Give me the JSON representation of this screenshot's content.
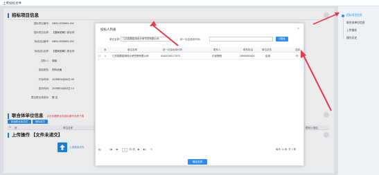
{
  "topbar": {
    "title": "上传投标文件"
  },
  "main": {
    "section1_title": "招标项目信息",
    "fields": [
      {
        "label": "招标项目编号:",
        "value": "HBSJ-2025061-004"
      },
      {
        "label": "招标项目名称:",
        "value": "【国家统筹】综合评估"
      },
      {
        "label": "标段(包)编号:",
        "value": "HBSJ-2025061-004"
      },
      {
        "label": "标段(包)名称:",
        "value": "【国家统筹】综合评估"
      },
      {
        "label": "招标人:",
        "value": "湖南"
      },
      {
        "label": "招标类型:",
        "value": "材料设备"
      },
      {
        "label": "开标时间:",
        "value": "2025年04月30日 09"
      },
      {
        "label": "投标时间:",
        "value": "2025年04月02日 14"
      },
      {
        "label": "是否联合体投标:",
        "value": "是 否"
      }
    ],
    "section2_title": "联合体单位信息",
    "section2_note": "点击查看联合体投标操作手册下载",
    "btn_add": "新增联合体成员",
    "btn_delete": "删除成员",
    "table2_headers": [
      "序",
      "单位名称",
      "联系人电话"
    ],
    "section3_title": "上传操作 【文件未递交】",
    "upload_label": "上传投标文件"
  },
  "sidebar": {
    "items": [
      "招标项目信息",
      "联合体单位信息",
      "上传操作",
      "操作历史"
    ],
    "active_index": 0
  },
  "modal": {
    "title": "投标人列表",
    "close": "×",
    "name_label": "单位名称:",
    "name_value": "江苏国泰勘测设计研究院有限公司",
    "code_label": "统一社会信用代码:",
    "code_value": "",
    "search_btn": "搜索",
    "headers": [
      "序",
      "单位名称",
      "统一社会信用代码",
      "联系人",
      "联系电话",
      "单位状态",
      "选择"
    ],
    "rows": [
      {
        "index": "1",
        "name": "江苏国泰勘测设计研究院有限公司",
        "code": "91A20100177670...",
        "contact": "中宫骁骁",
        "phone": "18900000000",
        "status": "启用",
        "select": "⊙"
      }
    ],
    "pager": {
      "size": "10",
      "prev_first": "|◀",
      "prev": "◀",
      "page": "1",
      "of": "共1页",
      "next": "▶",
      "next_last": "▶|",
      "refresh": "↻",
      "summary": "每页 10 条, 共 1 条"
    },
    "confirm": "确定选择"
  },
  "colors": {
    "accent": "#2d8cf0",
    "arrow": "#e8394a"
  }
}
